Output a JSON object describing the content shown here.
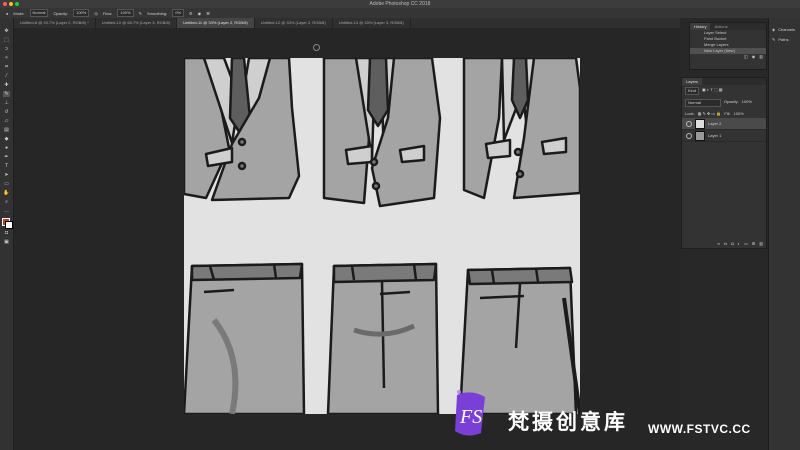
{
  "app": {
    "title": "Adobe Photoshop CC 2018"
  },
  "options_bar": {
    "mode_label": "Mode:",
    "mode_value": "Normal",
    "opacity_label": "Opacity:",
    "opacity_value": "100%",
    "flow_label": "Flow:",
    "flow_value": "100%",
    "smoothing_label": "Smoothing:",
    "smoothing_value": "0%"
  },
  "tabs": [
    "Untitled-8 @ 33.7% (Layer 2, RGB/8) *",
    "Untitled-10 @ 66.7% (Layer 3, RGB/8)",
    "Untitled-11 @ 33% (Layer 2, RGB/8)",
    "Untitled-12 @ 33% (Layer 2, RGB/8)",
    "Untitled-13 @ 33% (Layer 3, RGB/8)"
  ],
  "history_panel": {
    "tabs": [
      "History",
      "Actions"
    ],
    "items": [
      "Layer Select",
      "Paint Bucket",
      "Merge Layers",
      "New Layer (New)"
    ]
  },
  "layers_panel": {
    "title": "Layers",
    "kind_filter": "Kind",
    "blend_mode": "Normal",
    "opacity_label": "Opacity:",
    "opacity_value": "100%",
    "lock_label": "Lock:",
    "fill_label": "Fill:",
    "fill_value": "100%",
    "layers": [
      {
        "name": "Layer 2",
        "selected": true
      },
      {
        "name": "Layer 1",
        "selected": false
      }
    ]
  },
  "far_right": {
    "items": [
      "Channels",
      "Paths"
    ]
  },
  "watermark": {
    "brand": "梵摄创意库",
    "url": "WWW.FSTVC.CC",
    "logo": "FS"
  },
  "colors": {
    "accent_purple": "#7a3fd6",
    "accent_red": "#c0392b"
  }
}
